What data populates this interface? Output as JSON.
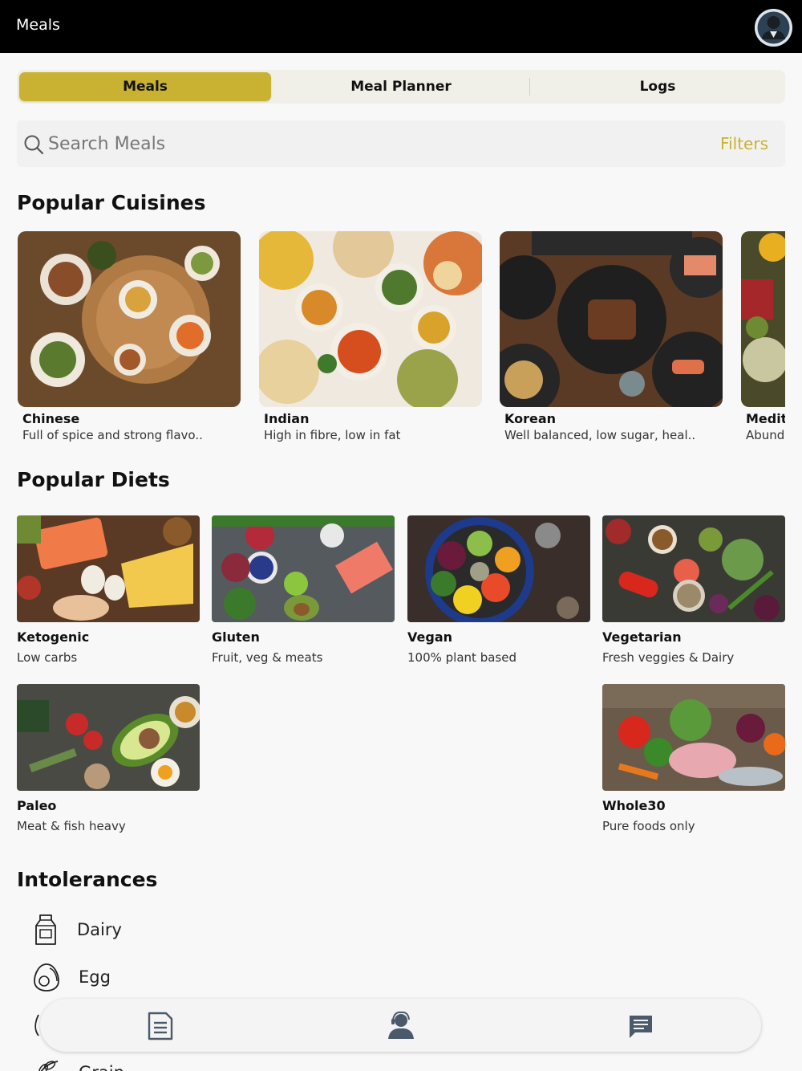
{
  "header": {
    "title": "Meals",
    "avatar_icon": "user-avatar"
  },
  "tabs": [
    {
      "label": "Meals",
      "active": true
    },
    {
      "label": "Meal Planner",
      "active": false
    },
    {
      "label": "Logs",
      "active": false
    }
  ],
  "search": {
    "placeholder": "Search Meals",
    "filters_label": "Filters",
    "icon": "search-icon"
  },
  "cuisines": {
    "heading": "Popular Cuisines",
    "items": [
      {
        "name": "Chinese",
        "desc": "Full of spice and strong flavo.."
      },
      {
        "name": "Indian",
        "desc": "High in fibre, low in fat"
      },
      {
        "name": "Korean",
        "desc": "Well balanced, low sugar, heal.."
      },
      {
        "name": "Medit",
        "desc": "Abund"
      }
    ]
  },
  "diets": {
    "heading": "Popular Diets",
    "items": [
      {
        "name": "Ketogenic",
        "desc": "Low carbs"
      },
      {
        "name": "Gluten",
        "desc": "Fruit, veg & meats"
      },
      {
        "name": "Vegan",
        "desc": "100% plant based"
      },
      {
        "name": "Vegetarian",
        "desc": "Fresh veggies & Dairy"
      },
      {
        "name": "Paleo",
        "desc": "Meat & fish heavy"
      },
      {
        "name": "Whole30",
        "desc": "Pure foods only"
      }
    ]
  },
  "intolerances": {
    "heading": "Intolerances",
    "items": [
      {
        "label": "Dairy",
        "icon": "milk-carton-icon"
      },
      {
        "label": "Egg",
        "icon": "egg-icon"
      },
      {
        "label": "",
        "icon": "partial-icon"
      },
      {
        "label": "Grain",
        "icon": "grain-icon"
      }
    ]
  },
  "bottom_nav": [
    {
      "icon": "document-icon"
    },
    {
      "icon": "user-support-icon"
    },
    {
      "icon": "chat-icon"
    }
  ],
  "colors": {
    "accent": "#c9b232",
    "topbar": "#000000",
    "background": "#f8f8f8"
  }
}
